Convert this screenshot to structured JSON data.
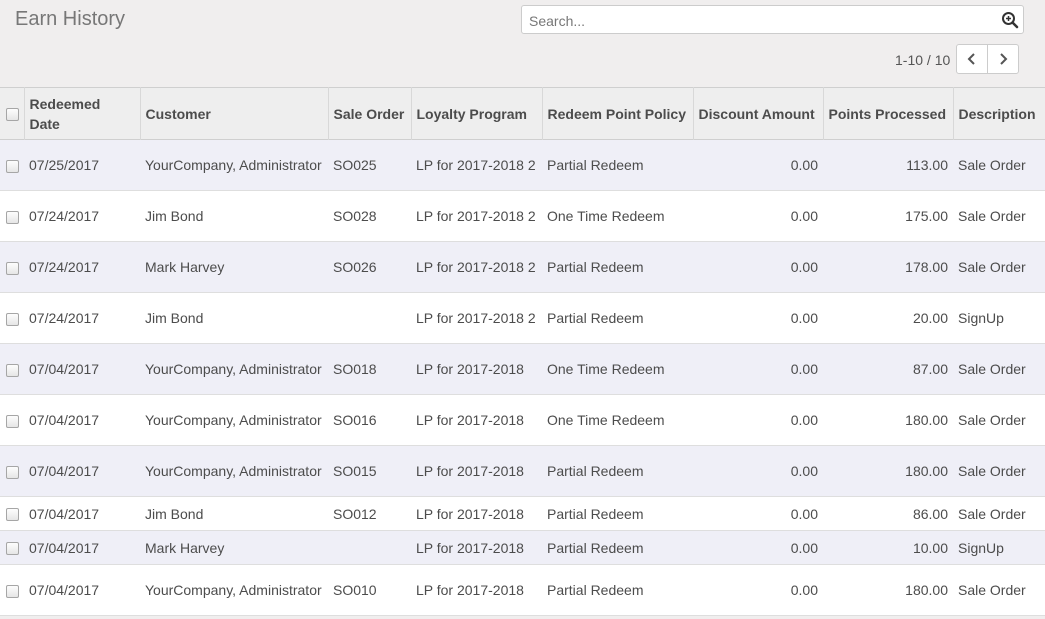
{
  "header": {
    "title": "Earn History",
    "search_placeholder": "Search...",
    "pager_text": "1-10 / 10"
  },
  "table": {
    "columns": [
      "Redeemed Date",
      "Customer",
      "Sale Order",
      "Loyalty Program",
      "Redeem Point Policy",
      "Discount Amount",
      "Points Processed",
      "Description"
    ],
    "rows": [
      {
        "date": "07/25/2017",
        "customer": "YourCompany, Administrator",
        "order": "SO025",
        "program": "LP for 2017-2018 2",
        "policy": "Partial Redeem",
        "discount": "0.00",
        "points": "113.00",
        "description": "Sale Order"
      },
      {
        "date": "07/24/2017",
        "customer": "Jim Bond",
        "order": "SO028",
        "program": "LP for 2017-2018 2",
        "policy": "One Time Redeem",
        "discount": "0.00",
        "points": "175.00",
        "description": "Sale Order"
      },
      {
        "date": "07/24/2017",
        "customer": "Mark Harvey",
        "order": "SO026",
        "program": "LP for 2017-2018 2",
        "policy": "Partial Redeem",
        "discount": "0.00",
        "points": "178.00",
        "description": "Sale Order"
      },
      {
        "date": "07/24/2017",
        "customer": "Jim Bond",
        "order": "",
        "program": "LP for 2017-2018 2",
        "policy": "Partial Redeem",
        "discount": "0.00",
        "points": "20.00",
        "description": "SignUp"
      },
      {
        "date": "07/04/2017",
        "customer": "YourCompany, Administrator",
        "order": "SO018",
        "program": "LP for 2017-2018",
        "policy": "One Time Redeem",
        "discount": "0.00",
        "points": "87.00",
        "description": "Sale Order"
      },
      {
        "date": "07/04/2017",
        "customer": "YourCompany, Administrator",
        "order": "SO016",
        "program": "LP for 2017-2018",
        "policy": "One Time Redeem",
        "discount": "0.00",
        "points": "180.00",
        "description": "Sale Order"
      },
      {
        "date": "07/04/2017",
        "customer": "YourCompany, Administrator",
        "order": "SO015",
        "program": "LP for 2017-2018",
        "policy": "Partial Redeem",
        "discount": "0.00",
        "points": "180.00",
        "description": "Sale Order"
      },
      {
        "date": "07/04/2017",
        "customer": "Jim Bond",
        "order": "SO012",
        "program": "LP for 2017-2018",
        "policy": "Partial Redeem",
        "discount": "0.00",
        "points": "86.00",
        "description": "Sale Order"
      },
      {
        "date": "07/04/2017",
        "customer": "Mark Harvey",
        "order": "",
        "program": "LP for 2017-2018",
        "policy": "Partial Redeem",
        "discount": "0.00",
        "points": "10.00",
        "description": "SignUp"
      },
      {
        "date": "07/04/2017",
        "customer": "YourCompany, Administrator",
        "order": "SO010",
        "program": "LP for 2017-2018",
        "policy": "Partial Redeem",
        "discount": "0.00",
        "points": "180.00",
        "description": "Sale Order"
      }
    ]
  }
}
